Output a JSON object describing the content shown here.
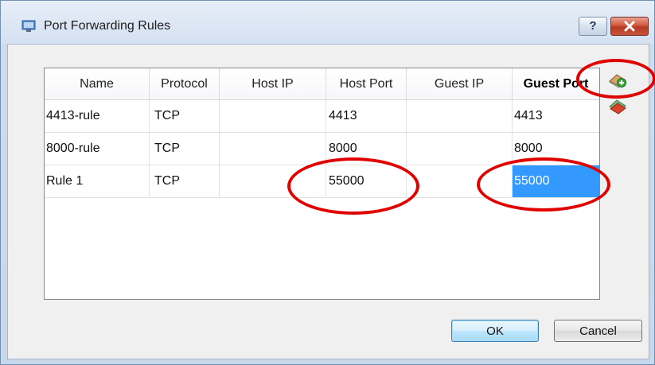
{
  "window": {
    "title": "Port Forwarding Rules",
    "help_label": "?",
    "close_label": "x"
  },
  "table": {
    "columns": [
      "Name",
      "Protocol",
      "Host IP",
      "Host Port",
      "Guest IP",
      "Guest Port"
    ],
    "rows": [
      {
        "name": "4413-rule",
        "protocol": "TCP",
        "host_ip": "",
        "host_port": "4413",
        "guest_ip": "",
        "guest_port": "4413"
      },
      {
        "name": "8000-rule",
        "protocol": "TCP",
        "host_ip": "",
        "host_port": "8000",
        "guest_ip": "",
        "guest_port": "8000"
      },
      {
        "name": "Rule 1",
        "protocol": "TCP",
        "host_ip": "",
        "host_port": "55000",
        "guest_ip": "",
        "guest_port": "55000"
      }
    ],
    "active_column": "Guest Port",
    "selected_cell": {
      "row": 2,
      "column": "Guest Port"
    }
  },
  "side_buttons": {
    "add_icon": "add-rule-icon",
    "remove_icon": "remove-rule-icon"
  },
  "buttons": {
    "ok_label": "OK",
    "cancel_label": "Cancel"
  },
  "colors": {
    "selection": "#3399ff",
    "annotation": "#e00000",
    "add_icon_green": "#3aa53a",
    "remove_icon_red": "#d8432b"
  }
}
